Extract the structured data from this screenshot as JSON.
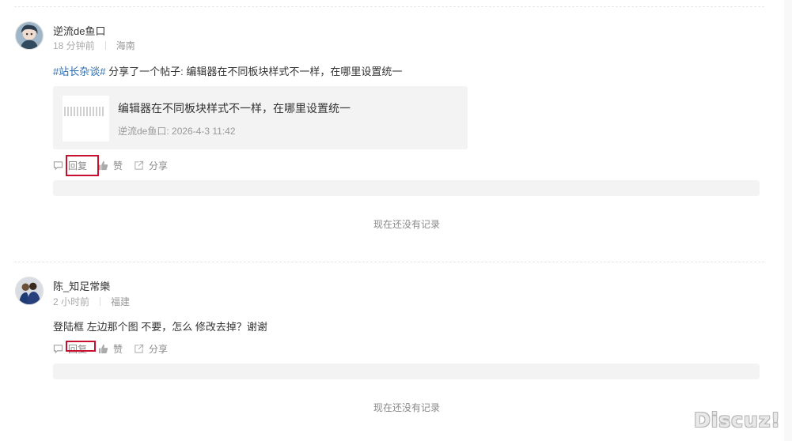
{
  "posts": [
    {
      "username": "逆流de鱼口",
      "time": "18 分钟前",
      "location": "海南",
      "topic": "#站长杂谈#",
      "content": "分享了一个帖子: 编辑器在不同板块样式不一样，在哪里设置统一",
      "quote": {
        "title": "编辑器在不同板块样式不一样，在哪里设置统一",
        "meta": "逆流de鱼口: 2026-4-3 11:42"
      },
      "actions": {
        "reply": "回复",
        "like": "赞",
        "share": "分享"
      },
      "empty_text": "现在还没有记录"
    },
    {
      "username": "陈_知足常樂",
      "time": "2 小时前",
      "location": "福建",
      "content": "登陆框 左边那个图 不要，怎么 修改去掉？谢谢",
      "actions": {
        "reply": "回复",
        "like": "赞",
        "share": "分享"
      },
      "empty_text": "现在还没有记录"
    }
  ],
  "watermark": "Discuz!",
  "icons": [
    "comment-icon",
    "thumbs-up-icon",
    "share-icon"
  ],
  "colors": {
    "topic": "#2b6cb0",
    "highlight": "#c8102e",
    "panel": "#f3f3f3"
  }
}
